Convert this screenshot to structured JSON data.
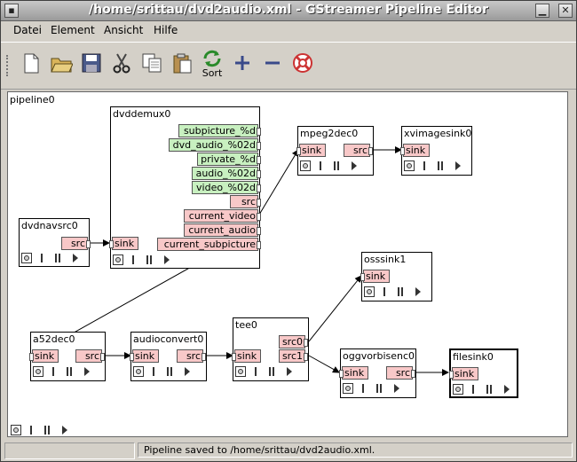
{
  "window": {
    "title": "/home/srittau/dvd2audio.xml - GStreamer Pipeline Editor"
  },
  "menu": {
    "datei": "Datei",
    "element": "Element",
    "ansicht": "Ansicht",
    "hilfe": "Hilfe"
  },
  "toolbar": {
    "sort_label": "Sort"
  },
  "canvas": {
    "pipeline_name": "pipeline0"
  },
  "elements": {
    "dvdnavsrc0": {
      "name": "dvdnavsrc0",
      "pads": [
        "src"
      ]
    },
    "dvddemux0": {
      "name": "dvddemux0",
      "pads": [
        "sink",
        "subpicture_%d",
        "dvd_audio_%02d",
        "private_%d",
        "audio_%02d",
        "video_%02d",
        "src",
        "current_video",
        "current_audio",
        "current_subpicture"
      ]
    },
    "mpeg2dec0": {
      "name": "mpeg2dec0",
      "pads": [
        "sink",
        "src"
      ]
    },
    "xvimagesink0": {
      "name": "xvimagesink0",
      "pads": [
        "sink"
      ]
    },
    "osssink1": {
      "name": "osssink1",
      "pads": [
        "sink"
      ]
    },
    "a52dec0": {
      "name": "a52dec0",
      "pads": [
        "sink",
        "src"
      ]
    },
    "audioconvert0": {
      "name": "audioconvert0",
      "pads": [
        "sink",
        "src"
      ]
    },
    "tee0": {
      "name": "tee0",
      "pads": [
        "sink",
        "src0",
        "src1"
      ]
    },
    "oggvorbisenc0": {
      "name": "oggvorbisenc0",
      "pads": [
        "sink",
        "src"
      ]
    },
    "filesink0": {
      "name": "filesink0",
      "pads": [
        "sink"
      ]
    }
  },
  "status": {
    "message": "Pipeline saved to /home/srittau/dvd2audio.xml."
  }
}
